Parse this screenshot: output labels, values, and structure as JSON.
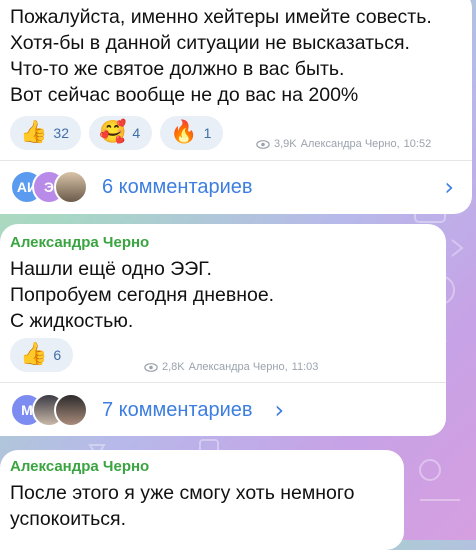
{
  "posts": [
    {
      "text": "Пожалуйста, именно хейтеры имейте совесть.\nХотя-бы в данной ситуации не высказаться.\nЧто-то же святое должно в вас быть.\nВот сейчас вообще не до вас на 200%",
      "reactions": [
        {
          "emoji": "👍",
          "icon": "thumbs-up-icon",
          "count": "32"
        },
        {
          "emoji": "🥰",
          "icon": "smiling-face-with-hearts-icon",
          "count": "4"
        },
        {
          "emoji": "🔥",
          "icon": "fire-icon",
          "count": "1"
        }
      ],
      "views": "3,9K",
      "author": "Александра Черно,",
      "time": "10:52",
      "comments_label": "6 комментариев",
      "avatar_initials": [
        "АИ",
        "Э"
      ]
    },
    {
      "sender": "Александра Черно",
      "text": "Нашли ещё одно ЭЭГ.\nПопробуем сегодня дневное.\nС жидкостью.",
      "reactions": [
        {
          "emoji": "👍",
          "icon": "thumbs-up-icon",
          "count": "6"
        }
      ],
      "views": "2,8K",
      "author": "Александра Черно,",
      "time": "11:03",
      "comments_label": "7 комментариев",
      "avatar_initials": [
        "М"
      ]
    },
    {
      "sender": "Александра Черно",
      "text": "После этого я уже смогу хоть немного\nуспокоиться."
    }
  ],
  "colors": {
    "sender": "#3aa441",
    "link": "#3d7ee0",
    "reaction_bg": "#e9eff6",
    "avatar_ai": "#5a9bf0",
    "avatar_e": "#b98be8",
    "avatar_m": "#7c8cf0"
  }
}
